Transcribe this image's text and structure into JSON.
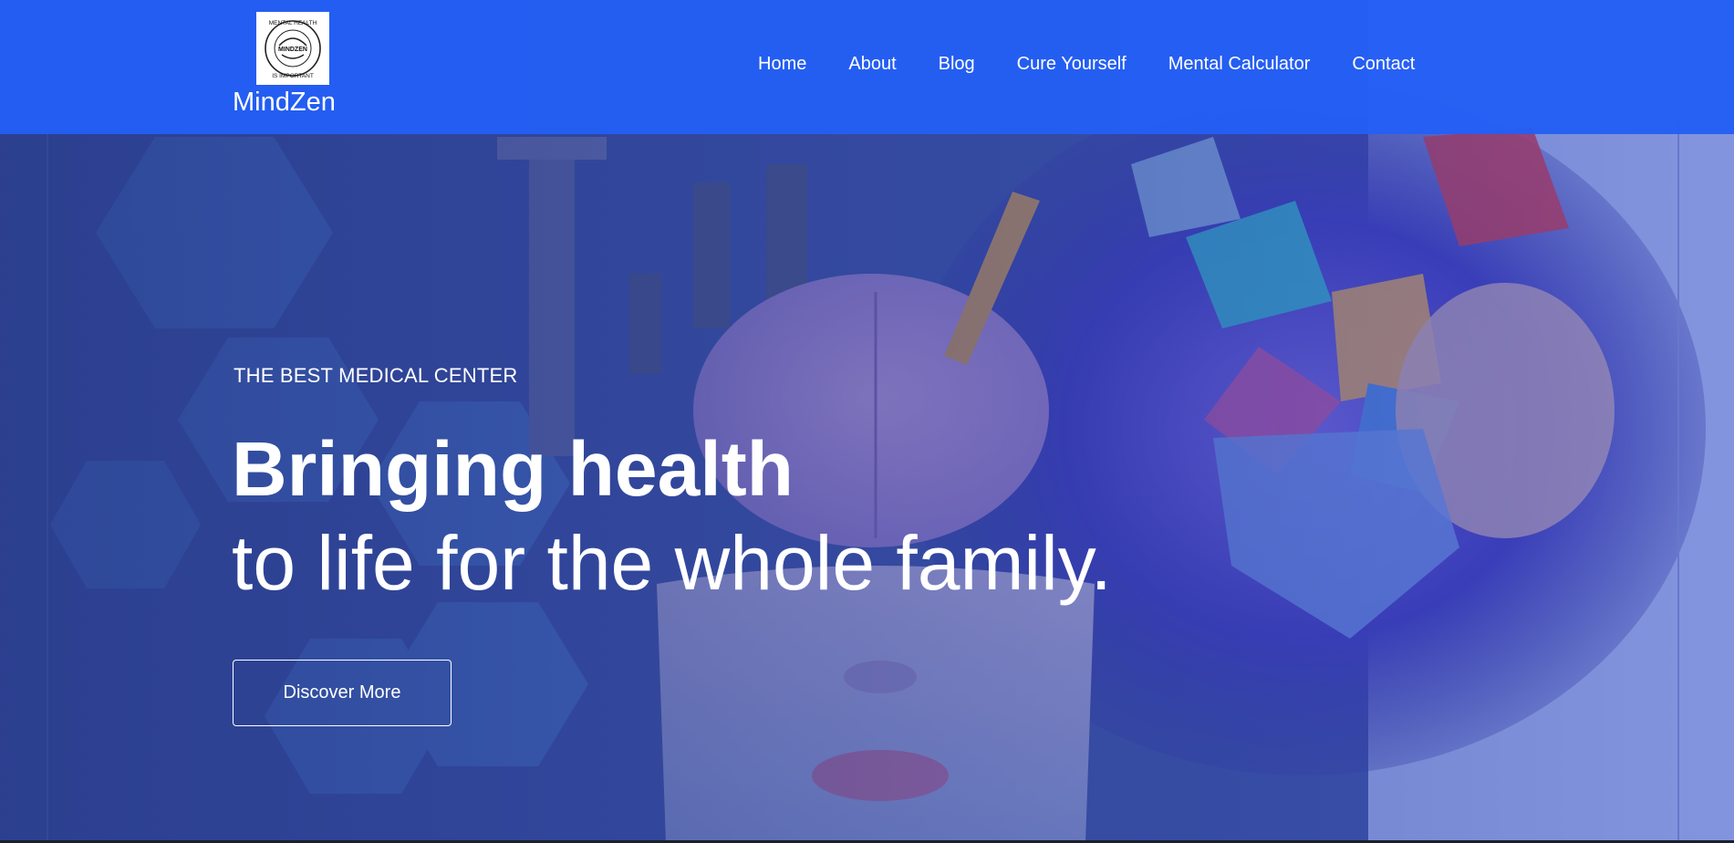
{
  "brand": {
    "name": "MindZen",
    "logo_ring_text_top": "MENTAL HEALTH",
    "logo_center_text": "MINDZEN",
    "logo_ring_text_bottom": "IS IMPORTANT"
  },
  "nav": {
    "items": [
      {
        "label": "Home"
      },
      {
        "label": "About"
      },
      {
        "label": "Blog"
      },
      {
        "label": "Cure Yourself"
      },
      {
        "label": "Mental Calculator"
      },
      {
        "label": "Contact"
      }
    ]
  },
  "hero": {
    "eyebrow": "THE BEST MEDICAL CENTER",
    "headline_line1": "Bringing health",
    "headline_line2": "to life for the whole family.",
    "cta_label": "Discover More"
  },
  "colors": {
    "navbar": "#235ff5",
    "text": "#ffffff",
    "overlay": "#2c3c8c"
  }
}
